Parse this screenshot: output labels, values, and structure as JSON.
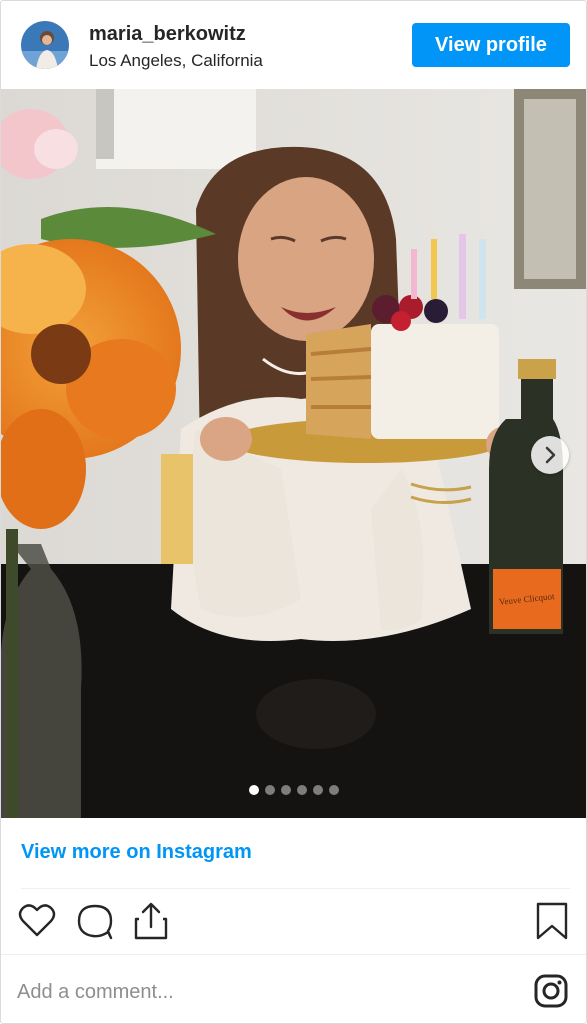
{
  "header": {
    "username": "maria_berkowitz",
    "location": "Los Angeles, California",
    "view_profile_label": "View profile"
  },
  "media": {
    "slide_count": 6,
    "active_slide": 1,
    "bottle_label": "Veuve Clicquot",
    "next_icon": "chevron-right-icon"
  },
  "view_more_label": "View more on Instagram",
  "actions": {
    "like_icon": "heart-icon",
    "comment_icon": "comment-icon",
    "share_icon": "share-icon",
    "save_icon": "bookmark-icon"
  },
  "comment": {
    "placeholder": "Add a comment...",
    "logo_icon": "instagram-icon"
  },
  "colors": {
    "accent": "#0095f6",
    "text": "#262626",
    "muted": "#8e8e8e"
  }
}
